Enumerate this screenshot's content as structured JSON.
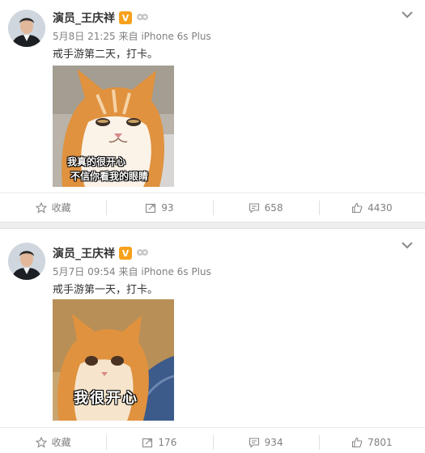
{
  "posts": [
    {
      "author": "演员_王庆祥",
      "verified_badge": "V",
      "date": "5月8日 21:25",
      "source_prefix": "来自",
      "source": "iPhone 6s Plus",
      "text": "戒手游第二天，打卡。",
      "caption_line1": "我真的很开心",
      "caption_line2": "不信你看我的眼睛",
      "actions": {
        "favorite": "收藏",
        "repost": "93",
        "comment": "658",
        "like": "4430"
      }
    },
    {
      "author": "演员_王庆祥",
      "verified_badge": "V",
      "date": "5月7日 09:54",
      "source_prefix": "来自",
      "source": "iPhone 6s Plus",
      "text": "戒手游第一天，打卡。",
      "caption_line1": "我很开心",
      "actions": {
        "favorite": "收藏",
        "repost": "176",
        "comment": "934",
        "like": "7801"
      }
    }
  ],
  "colors": {
    "badge": "#f7a11b",
    "muted_text": "#808080",
    "cat_orange": "#e0923f"
  },
  "icons": {
    "favorite": "star-icon",
    "repost": "repost-icon",
    "comment": "comment-icon",
    "like": "thumbs-up-icon",
    "menu": "chevron-down-icon"
  }
}
